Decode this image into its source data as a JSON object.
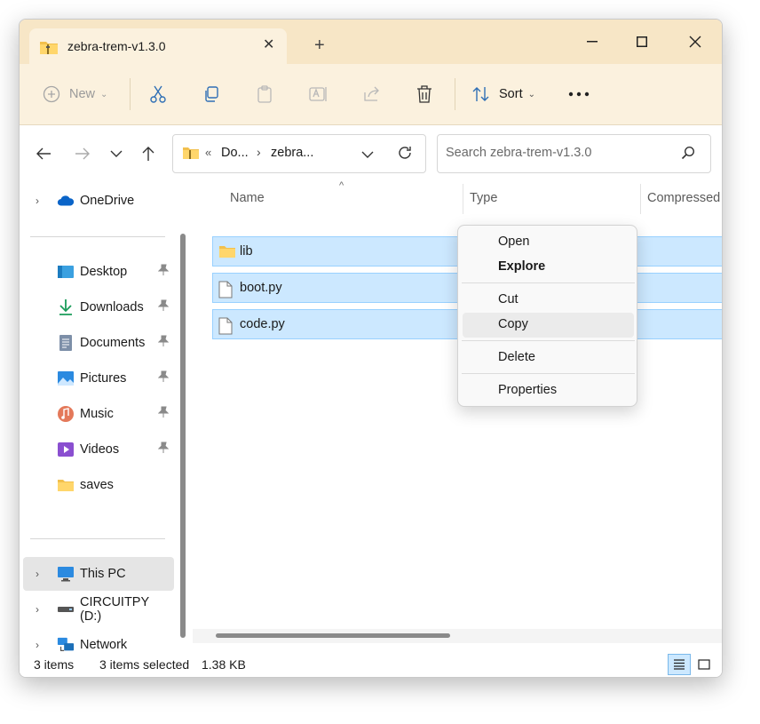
{
  "tab": {
    "title": "zebra-trem-v1.3.0"
  },
  "toolbar": {
    "new_label": "New",
    "sort_label": "Sort"
  },
  "address": {
    "part1": "Do...",
    "part2": "zebra..."
  },
  "search": {
    "placeholder": "Search zebra-trem-v1.3.0"
  },
  "sidebar": {
    "onedrive": "OneDrive",
    "quick_access": [
      {
        "label": "Desktop",
        "icon": "desktop-icon",
        "pinned": true
      },
      {
        "label": "Downloads",
        "icon": "downloads-icon",
        "pinned": true
      },
      {
        "label": "Documents",
        "icon": "documents-icon",
        "pinned": true
      },
      {
        "label": "Pictures",
        "icon": "pictures-icon",
        "pinned": true
      },
      {
        "label": "Music",
        "icon": "music-icon",
        "pinned": true
      },
      {
        "label": "Videos",
        "icon": "videos-icon",
        "pinned": true
      },
      {
        "label": "saves",
        "icon": "folder-icon",
        "pinned": false
      }
    ],
    "this_pc": "This PC",
    "circuitpy": "CIRCUITPY (D:)",
    "network": "Network"
  },
  "columns": {
    "name": "Name",
    "type": "Type",
    "compressed": "Compressed"
  },
  "files": [
    {
      "name": "lib",
      "icon": "folder-icon"
    },
    {
      "name": "boot.py",
      "icon": "file-icon"
    },
    {
      "name": "code.py",
      "icon": "file-icon"
    }
  ],
  "context_menu": {
    "open": "Open",
    "explore": "Explore",
    "cut": "Cut",
    "copy": "Copy",
    "delete": "Delete",
    "properties": "Properties"
  },
  "status": {
    "count": "3 items",
    "selected": "3 items selected",
    "size": "1.38 KB"
  },
  "colors": {
    "titlebar": "#f7e6c6",
    "toolbar": "#fbf1de",
    "selection": "#cce8ff",
    "accent": "#0067c0"
  }
}
